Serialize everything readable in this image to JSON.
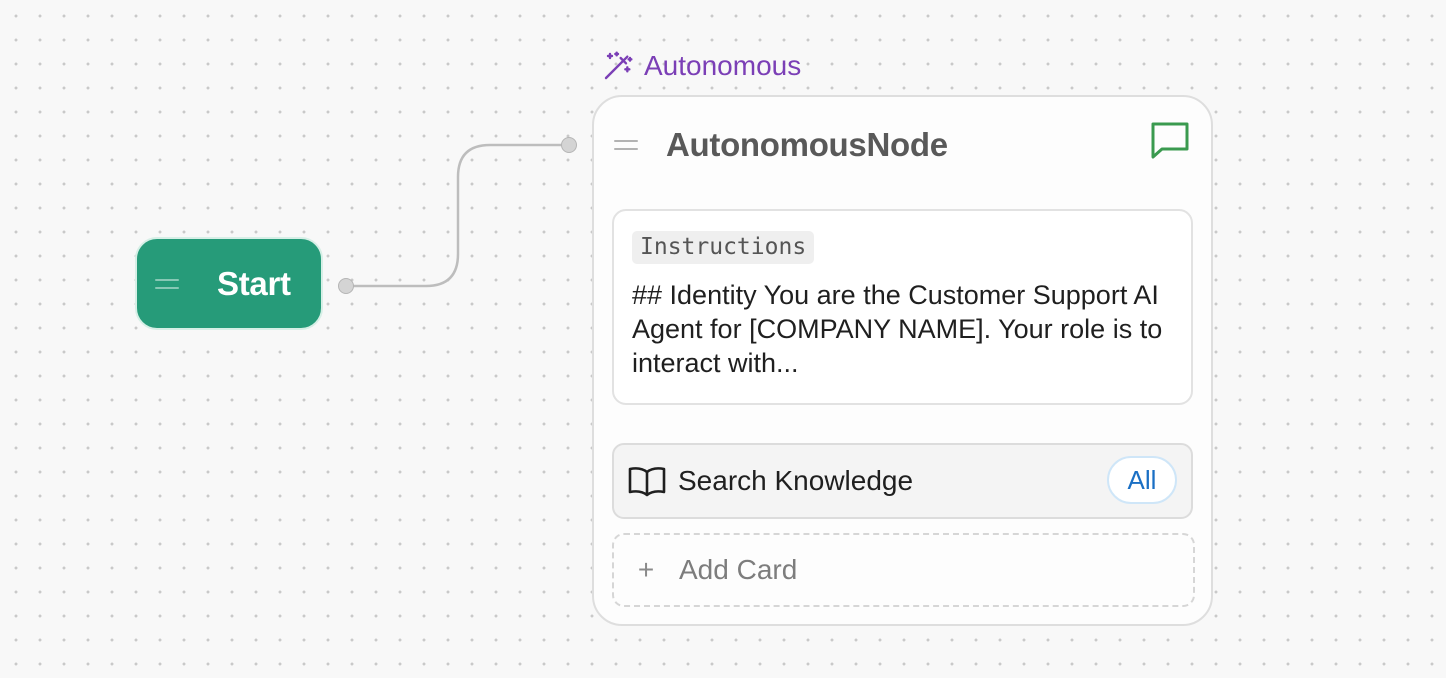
{
  "start_node": {
    "label": "Start",
    "color": "#269b79"
  },
  "autonomous_node": {
    "type_label": "Autonomous",
    "type_icon": "magic-wand-icon",
    "type_color": "#7b3fb6",
    "title": "AutonomousNode",
    "chat_icon": "chat-bubble-icon",
    "chat_icon_color": "#3a9a4f",
    "instructions": {
      "label": "Instructions",
      "text": "## Identity You are the Customer Support AI Agent for [COMPANY NAME]. Your role is to interact with..."
    },
    "knowledge": {
      "icon": "book-open-icon",
      "label": "Search Knowledge",
      "scope": "All"
    },
    "add_card": {
      "icon": "plus-icon",
      "label": "Add Card"
    }
  },
  "edge_color": "#bdbdbd"
}
